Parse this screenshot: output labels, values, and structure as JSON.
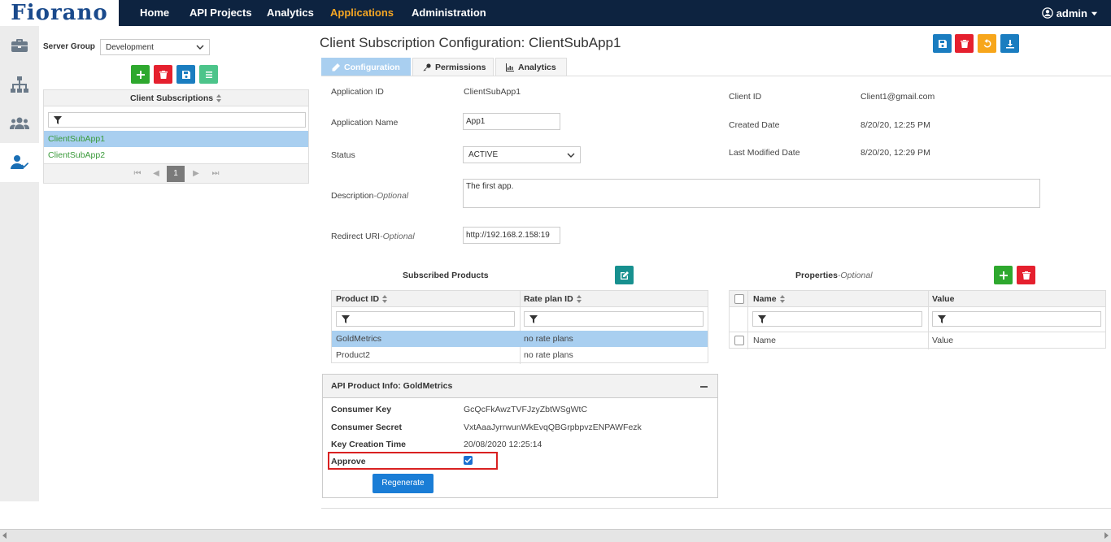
{
  "logo": "Fiorano",
  "nav": {
    "items": [
      "Home",
      "API Projects",
      "Analytics",
      "Applications",
      "Administration"
    ],
    "active_index": 3,
    "user": "admin"
  },
  "rail": {
    "icons": [
      "briefcase-icon",
      "hierarchy-icon",
      "users-icon",
      "user-check-icon"
    ],
    "active_index": 3
  },
  "left": {
    "server_group_label": "Server Group",
    "server_group_value": "Development",
    "panel_title": "Client Subscriptions",
    "rows": [
      "ClientSubApp1",
      "ClientSubApp2"
    ],
    "selected_index": 0,
    "page": "1"
  },
  "main": {
    "title": "Client Subscription Configuration: ClientSubApp1",
    "tabs": [
      "Configuration",
      "Permissions",
      "Analytics"
    ],
    "active_tab": 0,
    "fields": {
      "application_id_label": "Application ID",
      "application_id": "ClientSubApp1",
      "application_name_label": "Application Name",
      "application_name": "App1",
      "status_label": "Status",
      "status": "ACTIVE",
      "description_label": "Description",
      "description_optional": "-Optional",
      "description": "The first app.",
      "redirect_label": "Redirect URI",
      "redirect_optional": "-Optional",
      "redirect": "http://192.168.2.158:19",
      "client_id_label": "Client ID",
      "client_id": "Client1@gmail.com",
      "created_label": "Created Date",
      "created": "8/20/20, 12:25 PM",
      "modified_label": "Last Modified Date",
      "modified": "8/20/20, 12:29 PM"
    },
    "subscribed": {
      "title": "Subscribed Products",
      "col1": "Product ID",
      "col2": "Rate plan ID",
      "rows": [
        {
          "product": "GoldMetrics",
          "rate": "no rate plans"
        },
        {
          "product": "Product2",
          "rate": "no rate plans"
        }
      ],
      "selected_index": 0
    },
    "properties": {
      "title": "Properties",
      "optional": "-Optional",
      "col1": "Name",
      "col2": "Value",
      "rows": [
        {
          "name": "Name",
          "value": "Value"
        }
      ]
    },
    "info": {
      "title": "API Product Info: GoldMetrics",
      "consumer_key_label": "Consumer Key",
      "consumer_key": "GcQcFkAwzTVFJzyZbtWSgWtC",
      "consumer_secret_label": "Consumer Secret",
      "consumer_secret": "VxtAaaJyrrwunWkEvqQBGrpbpvzENPAWFezk",
      "key_time_label": "Key Creation Time",
      "key_time": "20/08/2020 12:25:14",
      "approve_label": "Approve",
      "approved": true,
      "regenerate_label": "Regenerate"
    }
  },
  "colors": {
    "nav_bg": "#0d2340",
    "nav_active": "#f5a623",
    "selection": "#a9cff0",
    "green": "#2ea82e",
    "red": "#e5202e",
    "blue": "#1a7dc0",
    "highlight": "#d92121"
  }
}
